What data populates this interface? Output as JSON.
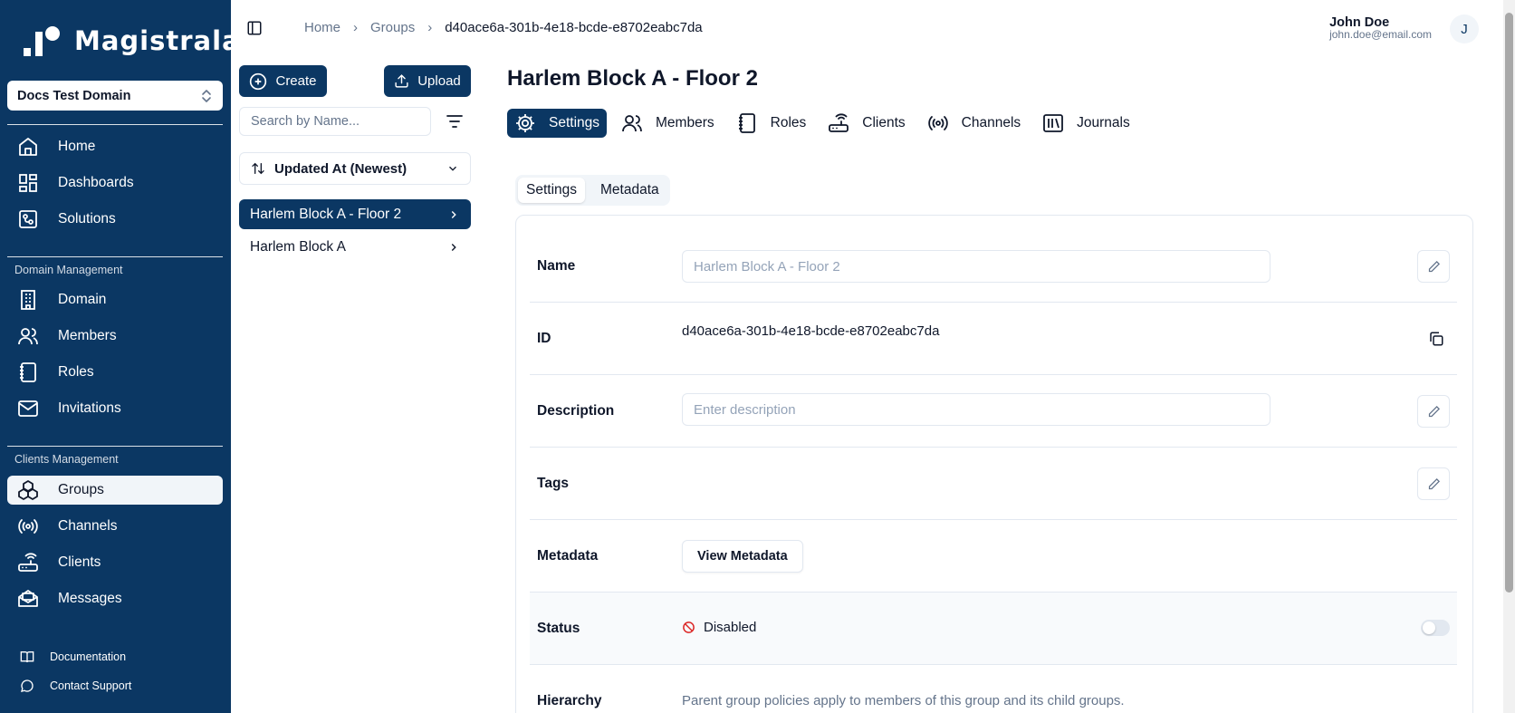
{
  "app": {
    "name": "Magistrala"
  },
  "sidebar": {
    "domain_select": "Docs Test Domain",
    "main_items": [
      {
        "label": "Home",
        "icon": "home-icon"
      },
      {
        "label": "Dashboards",
        "icon": "dashboard-icon"
      },
      {
        "label": "Solutions",
        "icon": "solutions-icon"
      }
    ],
    "domain_management": {
      "title": "Domain Management",
      "items": [
        {
          "label": "Domain",
          "icon": "building-icon"
        },
        {
          "label": "Members",
          "icon": "users-icon"
        },
        {
          "label": "Roles",
          "icon": "notebook-icon"
        },
        {
          "label": "Invitations",
          "icon": "mail-icon"
        }
      ]
    },
    "clients_management": {
      "title": "Clients Management",
      "items": [
        {
          "label": "Groups",
          "icon": "boxes-icon",
          "active": true
        },
        {
          "label": "Channels",
          "icon": "radio-icon"
        },
        {
          "label": "Clients",
          "icon": "router-icon"
        },
        {
          "label": "Messages",
          "icon": "mail-open-icon"
        }
      ]
    },
    "footer": [
      {
        "label": "Documentation",
        "icon": "book-icon"
      },
      {
        "label": "Contact Support",
        "icon": "message-circle-icon"
      }
    ]
  },
  "header": {
    "breadcrumb": [
      "Home",
      "Groups",
      "d40ace6a-301b-4e18-bcde-e8702eabc7da"
    ],
    "user": {
      "name": "John Doe",
      "email": "john.doe@email.com",
      "initial": "J"
    }
  },
  "list_panel": {
    "create_label": "Create",
    "upload_label": "Upload",
    "search_placeholder": "Search by Name...",
    "sort_label": "Updated At (Newest)",
    "groups": [
      {
        "name": "Harlem Block A - Floor 2",
        "active": true
      },
      {
        "name": "Harlem Block A",
        "active": false
      }
    ]
  },
  "main": {
    "title": "Harlem Block A - Floor 2",
    "tabs": [
      {
        "label": "Settings",
        "icon": "gear-icon",
        "active": true
      },
      {
        "label": "Members",
        "icon": "users-icon"
      },
      {
        "label": "Roles",
        "icon": "notebook-icon"
      },
      {
        "label": "Clients",
        "icon": "router-icon"
      },
      {
        "label": "Channels",
        "icon": "radio-icon"
      },
      {
        "label": "Journals",
        "icon": "library-icon"
      }
    ],
    "subtabs": [
      {
        "label": "Settings",
        "active": true
      },
      {
        "label": "Metadata",
        "active": false
      }
    ],
    "fields": {
      "name": {
        "label": "Name",
        "placeholder": "Harlem Block A - Floor 2"
      },
      "id": {
        "label": "ID",
        "value": "d40ace6a-301b-4e18-bcde-e8702eabc7da"
      },
      "description": {
        "label": "Description",
        "placeholder": "Enter description"
      },
      "tags": {
        "label": "Tags"
      },
      "metadata": {
        "label": "Metadata",
        "button": "View Metadata"
      },
      "status": {
        "label": "Status",
        "value": "Disabled"
      },
      "hierarchy": {
        "label": "Hierarchy",
        "text": "Parent group policies apply to members of this group and its child groups."
      }
    }
  },
  "colors": {
    "brand": "#0b3763",
    "status_disabled": "#dc2626"
  }
}
